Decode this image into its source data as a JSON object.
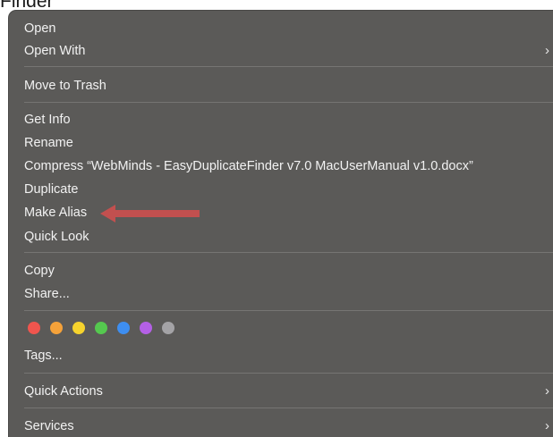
{
  "page_top_text": "Finder",
  "menu": {
    "items": [
      {
        "label": "Open"
      },
      {
        "label": "Open With"
      },
      {
        "label": "Move to Trash"
      },
      {
        "label": "Get Info"
      },
      {
        "label": "Rename"
      },
      {
        "label": "Compress “WebMinds - EasyDuplicateFinder v7.0 MacUserManual v1.0.docx”"
      },
      {
        "label": "Duplicate"
      },
      {
        "label": "Make Alias"
      },
      {
        "label": "Quick Look"
      },
      {
        "label": "Copy"
      },
      {
        "label": "Share..."
      },
      {
        "label": "Tags..."
      },
      {
        "label": "Quick Actions"
      },
      {
        "label": "Services"
      }
    ],
    "submenu_chevron": "›",
    "tag_colors": [
      {
        "name": "red",
        "color": "#f0554e"
      },
      {
        "name": "orange",
        "color": "#f5a23a"
      },
      {
        "name": "yellow",
        "color": "#f6d32d"
      },
      {
        "name": "green",
        "color": "#55c84f"
      },
      {
        "name": "blue",
        "color": "#3e8ef0"
      },
      {
        "name": "purple",
        "color": "#b460e6"
      },
      {
        "name": "gray",
        "color": "#a4a3a6"
      }
    ]
  },
  "annotation": {
    "arrow_color": "#c2504f",
    "points_to": "Make Alias"
  }
}
